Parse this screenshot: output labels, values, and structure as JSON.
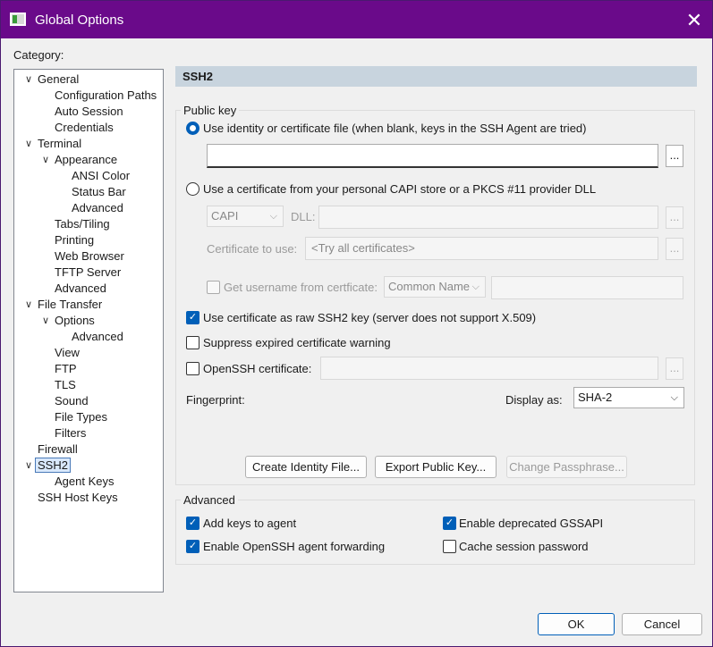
{
  "window": {
    "title": "Global Options",
    "close_glyph": "✕"
  },
  "sidebar": {
    "label": "Category:",
    "items": [
      {
        "label": "General",
        "level": 0,
        "chevron": "∨"
      },
      {
        "label": "Configuration Paths",
        "level": 1
      },
      {
        "label": "Auto Session",
        "level": 1
      },
      {
        "label": "Credentials",
        "level": 1
      },
      {
        "label": "Terminal",
        "level": 0,
        "chevron": "∨"
      },
      {
        "label": "Appearance",
        "level": 1,
        "chevron": "∨"
      },
      {
        "label": "ANSI Color",
        "level": 2
      },
      {
        "label": "Status Bar",
        "level": 2
      },
      {
        "label": "Advanced",
        "level": 2
      },
      {
        "label": "Tabs/Tiling",
        "level": 1
      },
      {
        "label": "Printing",
        "level": 1
      },
      {
        "label": "Web Browser",
        "level": 1
      },
      {
        "label": "TFTP Server",
        "level": 1
      },
      {
        "label": "Advanced",
        "level": 1
      },
      {
        "label": "File Transfer",
        "level": 0,
        "chevron": "∨"
      },
      {
        "label": "Options",
        "level": 1,
        "chevron": "∨"
      },
      {
        "label": "Advanced",
        "level": 2
      },
      {
        "label": "View",
        "level": 1
      },
      {
        "label": "FTP",
        "level": 1
      },
      {
        "label": "TLS",
        "level": 1
      },
      {
        "label": "Sound",
        "level": 1
      },
      {
        "label": "File Types",
        "level": 1
      },
      {
        "label": "Filters",
        "level": 1
      },
      {
        "label": "Firewall",
        "level": 0
      },
      {
        "label": "SSH2",
        "level": 0,
        "chevron": "∨",
        "selected": true
      },
      {
        "label": "Agent Keys",
        "level": 1
      },
      {
        "label": "SSH Host Keys",
        "level": 0
      }
    ]
  },
  "main": {
    "section_title": "SSH2",
    "public_key": {
      "legend": "Public key",
      "radio_identity_label": "Use identity or certificate file (when blank, keys in the SSH Agent are tried)",
      "identity_file_value": "",
      "browse_label": "...",
      "radio_capi_label": "Use a certificate from your personal CAPI store or a PKCS #11 provider DLL",
      "capi_select_value": "CAPI",
      "dll_label": "DLL:",
      "dll_value": "",
      "cert_to_use_label": "Certificate to use:",
      "cert_to_use_value": "<Try all certificates>",
      "get_username_label": "Get username from certficate:",
      "username_source_value": "Common Name",
      "username_value": "",
      "raw_ssh2_label": "Use certificate as raw SSH2 key (server does not support X.509)",
      "suppress_expired_label": "Suppress expired certificate warning",
      "openssh_cert_label": "OpenSSH certificate:",
      "openssh_cert_value": "",
      "fingerprint_label": "Fingerprint:",
      "display_as_label": "Display as:",
      "display_as_value": "SHA-2",
      "create_identity_label": "Create Identity File...",
      "export_public_key_label": "Export Public Key...",
      "change_passphrase_label": "Change Passphrase..."
    },
    "advanced": {
      "legend": "Advanced",
      "add_keys_label": "Add keys to agent",
      "enable_forwarding_label": "Enable OpenSSH agent forwarding",
      "deprecated_gssapi_label": "Enable deprecated GSSAPI",
      "cache_password_label": "Cache session password"
    }
  },
  "footer": {
    "ok_label": "OK",
    "cancel_label": "Cancel"
  },
  "colors": {
    "titlebar": "#6a0a8a",
    "accent": "#005fb8",
    "section_header": "#c8d4de"
  }
}
